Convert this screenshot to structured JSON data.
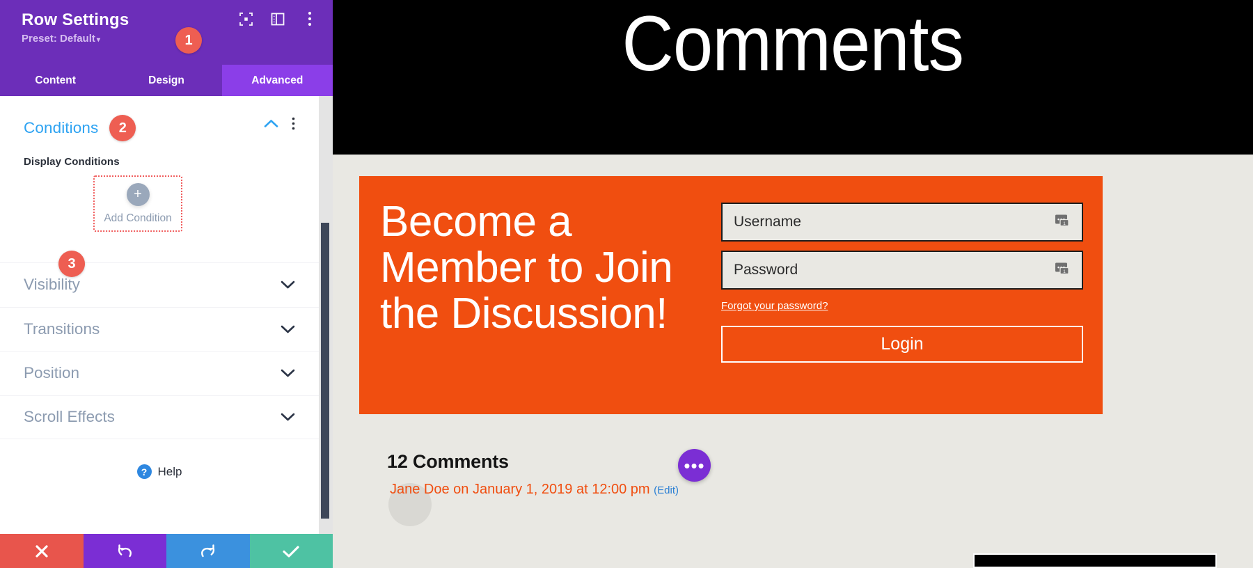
{
  "panel": {
    "title": "Row Settings",
    "preset_label": "Preset: Default",
    "preset_caret": "▾",
    "header_icons": [
      {
        "name": "focus-frame-icon"
      },
      {
        "name": "layout-columns-icon"
      },
      {
        "name": "kebab-menu-icon"
      }
    ],
    "tabs": [
      {
        "label": "Content",
        "active": false
      },
      {
        "label": "Design",
        "active": false
      },
      {
        "label": "Advanced",
        "active": true
      }
    ],
    "badges": {
      "one": "1",
      "two": "2",
      "three": "3"
    },
    "conditions": {
      "section_title": "Conditions",
      "field_label": "Display Conditions",
      "add_button_label": "Add Condition",
      "add_button_plus": "+"
    },
    "accordion": [
      {
        "label": "Visibility"
      },
      {
        "label": "Transitions"
      },
      {
        "label": "Position"
      },
      {
        "label": "Scroll Effects"
      }
    ],
    "help": {
      "icon_glyph": "?",
      "label": "Help"
    },
    "actions": [
      {
        "name": "discard-button",
        "glyph": "✖",
        "color": "#e8554c"
      },
      {
        "name": "undo-button",
        "glyph": "↺",
        "color": "#7b2ed4"
      },
      {
        "name": "redo-button",
        "glyph": "↻",
        "color": "#3b91de"
      },
      {
        "name": "save-button",
        "glyph": "✔",
        "color": "#4ec2a3"
      }
    ]
  },
  "page": {
    "hero_title": "Comments",
    "cta": {
      "heading": "Become a Member to Join the Discussion!",
      "username_label": "Username",
      "password_label": "Password",
      "forgot_link": "Forgot your password?",
      "login_button": "Login",
      "background_color": "#f04e10"
    },
    "comments": {
      "count_heading": "12 Comments",
      "fab_glyph": "•••",
      "first_comment_meta": "Jane Doe on January 1, 2019 at 12:00 pm",
      "first_comment_edit": "(Edit)"
    }
  }
}
